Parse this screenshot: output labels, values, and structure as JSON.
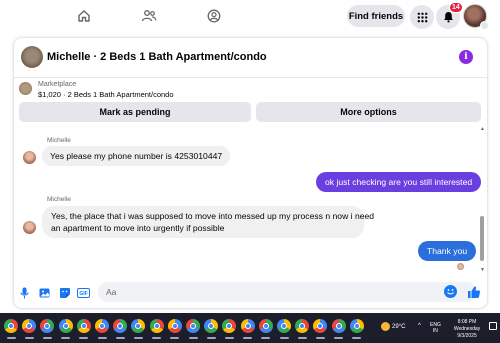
{
  "nav": {
    "icons": [
      "home-icon",
      "friends-icon",
      "profile-circle-icon"
    ],
    "find_friends_label": "Find friends",
    "notification_count": "14"
  },
  "chat": {
    "title": "Michelle · 2 Beds 1 Bath Apartment/condo",
    "marketplace_label": "Marketplace",
    "listing_detail": "$1,020 · 2 Beds 1 Bath Apartment/condo",
    "mark_pending_label": "Mark as pending",
    "more_options_label": "More options",
    "messages": [
      {
        "sender": "Michelle",
        "text": "Yes please my phone number is 4253010447",
        "direction": "in"
      },
      {
        "text": "ok just checking are you still interested",
        "direction": "out",
        "color": "#6a3fe0"
      },
      {
        "sender": "Michelle",
        "text_line1": "Yes, the place that i was supposed to move into messed up my process n now i need",
        "text_line2": "an apartment to move into urgently if possible",
        "direction": "in"
      },
      {
        "text": "Thank you",
        "direction": "out",
        "color": "#2b6fdc"
      }
    ],
    "composer_placeholder": "Aa",
    "composer_icons": [
      "microphone-icon",
      "photo-icon",
      "sticker-icon",
      "gif-icon",
      "emoji-icon",
      "thumbs-up-icon"
    ]
  },
  "taskbar": {
    "weather": "29°C",
    "lang_line1": "ENG",
    "lang_line2": "IN",
    "time": "8:08 PM",
    "day": "Wednesday",
    "date": "9/3/2025"
  },
  "colors": {
    "accent_blue": "#1877f2",
    "bubble_blue": "#2b6fdc",
    "bubble_purple": "#6a3fe0",
    "badge_red": "#e41e3f",
    "taskbar_bg": "#1c1f2b"
  }
}
